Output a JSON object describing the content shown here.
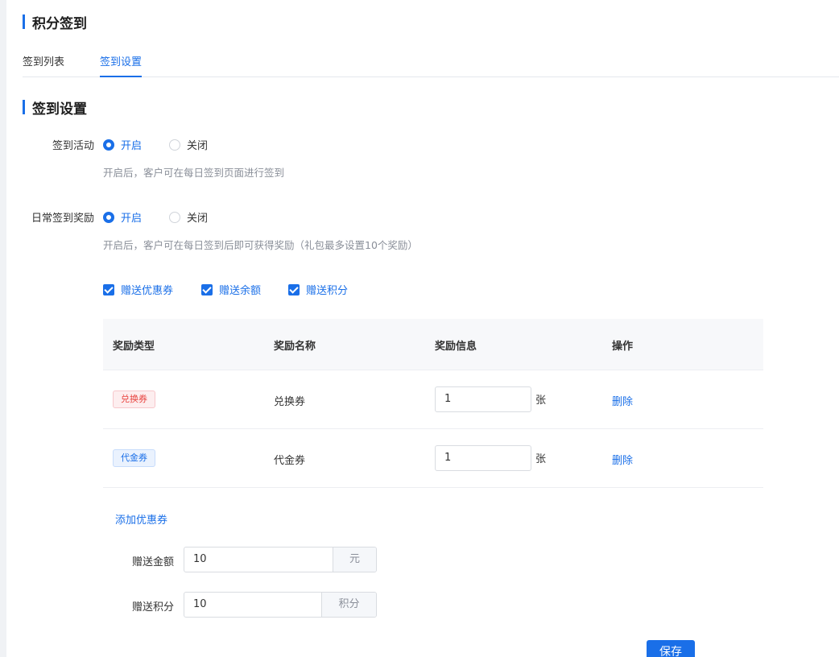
{
  "page": {
    "title": "积分签到"
  },
  "tabs": [
    {
      "label": "签到列表"
    },
    {
      "label": "签到设置"
    }
  ],
  "section": {
    "title": "签到设置"
  },
  "checkin": {
    "label": "签到活动",
    "on_label": "开启",
    "off_label": "关闭",
    "hint": "开启后，客户可在每日签到页面进行签到"
  },
  "reward": {
    "label": "日常签到奖励",
    "on_label": "开启",
    "off_label": "关闭",
    "hint": "开启后，客户可在每日签到后即可获得奖励（礼包最多设置10个奖励）"
  },
  "options": [
    {
      "label": "赠送优惠券"
    },
    {
      "label": "赠送余额"
    },
    {
      "label": "赠送积分"
    }
  ],
  "table": {
    "headers": [
      "奖励类型",
      "奖励名称",
      "奖励信息",
      "操作"
    ],
    "rows": [
      {
        "type": "兑换券",
        "name": "兑换券",
        "qty": "1",
        "unit": "张",
        "action": "删除"
      },
      {
        "type": "代金券",
        "name": "代金券",
        "qty": "1",
        "unit": "张",
        "action": "删除"
      }
    ]
  },
  "add_coupon": "添加优惠券",
  "balance": {
    "label": "赠送金额",
    "value": "10",
    "unit": "元"
  },
  "points": {
    "label": "赠送积分",
    "value": "10",
    "unit": "积分"
  },
  "save_label": "保存",
  "colors": {
    "primary": "#1a6fe8",
    "tag_red": "#e8433f"
  }
}
